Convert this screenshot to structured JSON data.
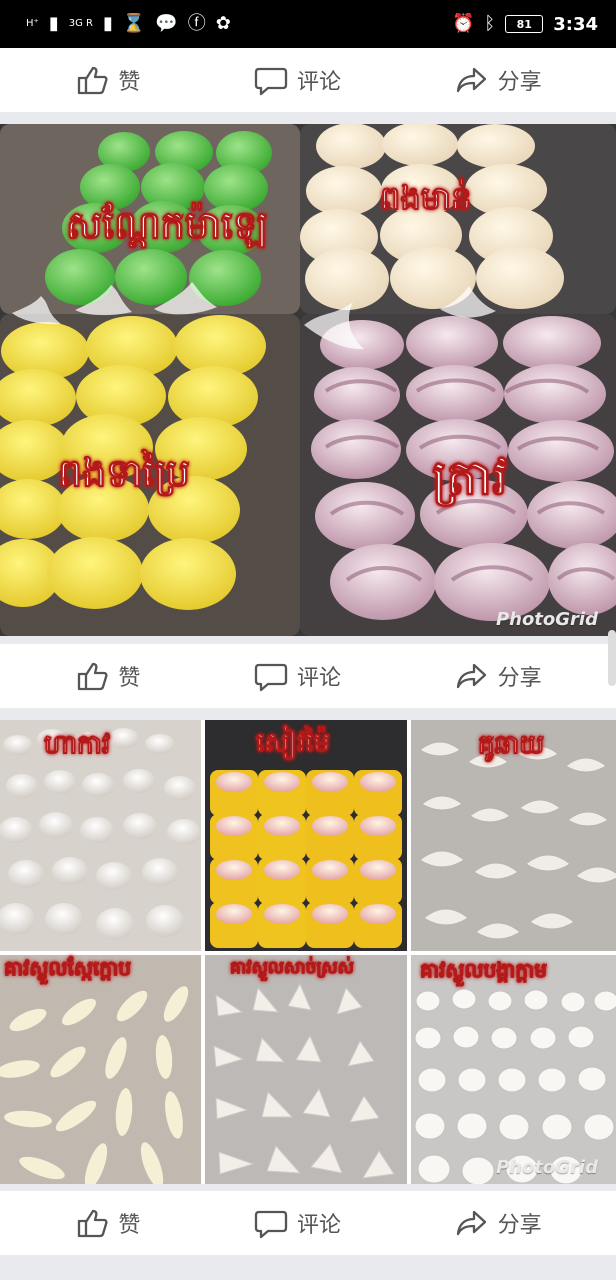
{
  "status_bar": {
    "network_1": "H⁺",
    "network_2": "3G R",
    "battery": "81",
    "time": "3:34"
  },
  "actions": {
    "like": "赞",
    "comment": "评论",
    "share": "分享"
  },
  "post_1": {
    "labels": {
      "green": "សណ្តែកម៉ាឡេ",
      "white": "ពងមាន់",
      "yellow": "ពងទាប្រៃ",
      "pink": "ត្រាវ"
    },
    "watermark": "PhotoGrid"
  },
  "post_2": {
    "labels": {
      "top_left": "ហាកាវ",
      "top_middle": "សៀវម៉ៃ",
      "top_right": "គូឆាយ",
      "bottom_left": "គាវស្ងួលស្កែក្ដោប",
      "bottom_middle": "គាវស្ងួលសាច់ស្រស់",
      "bottom_right": "គាវស្ងួលបង្គាក្ដាម"
    },
    "watermark": "PhotoGrid"
  },
  "icons": {
    "like": "thumbs-up-icon",
    "comment": "comment-bubble-icon",
    "share": "share-arrow-icon"
  },
  "colors": {
    "status_bar": "#000000",
    "text_red": "#b31919",
    "icon_gray": "#555555"
  }
}
